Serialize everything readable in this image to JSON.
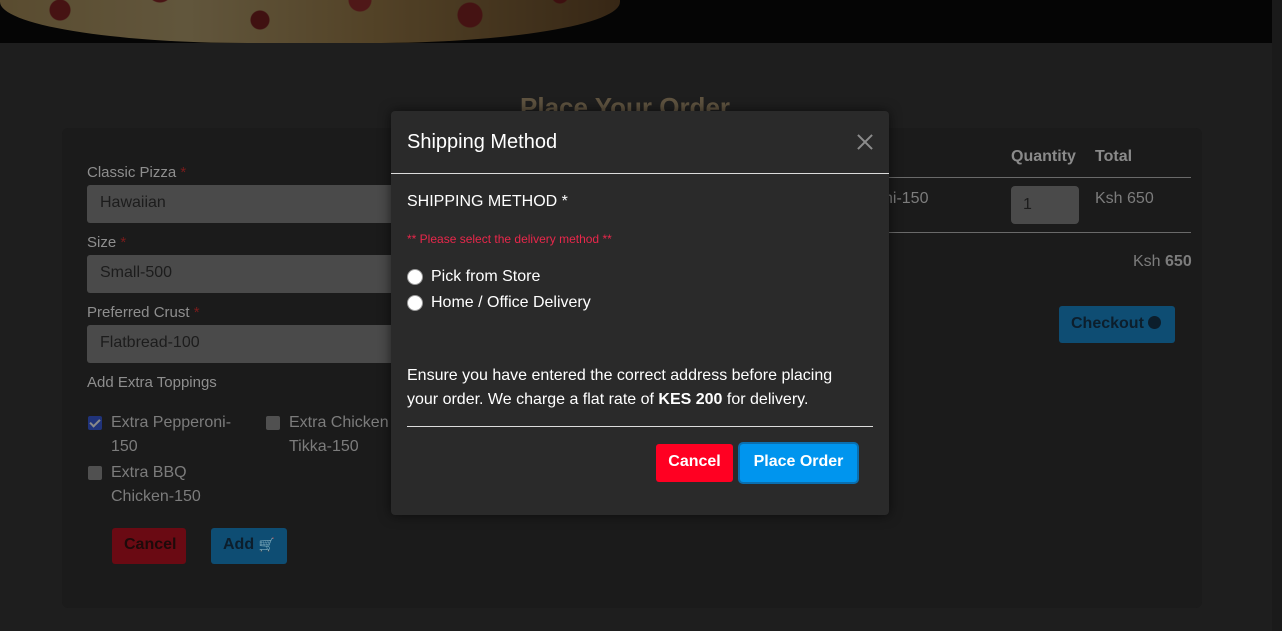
{
  "background": {
    "page_heading": "Place Your Order",
    "form": {
      "classic_pizza_label": "Classic Pizza",
      "classic_pizza_value": "Hawaiian",
      "size_label": "Size",
      "size_value": "Small-500",
      "crust_label": "Preferred Crust",
      "crust_value": "Flatbread-100",
      "required_mark": "*",
      "toppings_label": "Add Extra Toppings",
      "toppings": [
        {
          "line1": "Extra Pepperoni-",
          "line2": "150",
          "checked": true
        },
        {
          "line1": "Extra Chicken",
          "line2": "Tikka-150",
          "checked": false
        },
        {
          "line1": "Extra BBQ",
          "line2": "Chicken-150",
          "checked": false
        }
      ],
      "cancel_label": "Cancel",
      "add_label": "Add"
    },
    "cart": {
      "headers": {
        "quantity": "Quantity",
        "total": "Total"
      },
      "row": {
        "item_fragment": "ni-150",
        "quantity": "1",
        "total": "Ksh 650"
      },
      "grand_total_prefix": "Ksh",
      "grand_total_value": "650",
      "checkout_label": "Checkout"
    }
  },
  "modal": {
    "title": "Shipping Method",
    "section_label": "SHIPPING METHOD *",
    "warning": "** Please select the delivery method **",
    "options": [
      "Pick from Store",
      "Home / Office Delivery"
    ],
    "note_part1": "Ensure you have entered the correct address before placing your order. We charge a flat rate of",
    "note_bold": "KES 200",
    "note_part2": "for delivery.",
    "cancel_label": "Cancel",
    "place_order_label": "Place Order"
  },
  "colors": {
    "cancel": "#ff0022",
    "place_order": "#0095ee",
    "warning": "#e8274b"
  }
}
